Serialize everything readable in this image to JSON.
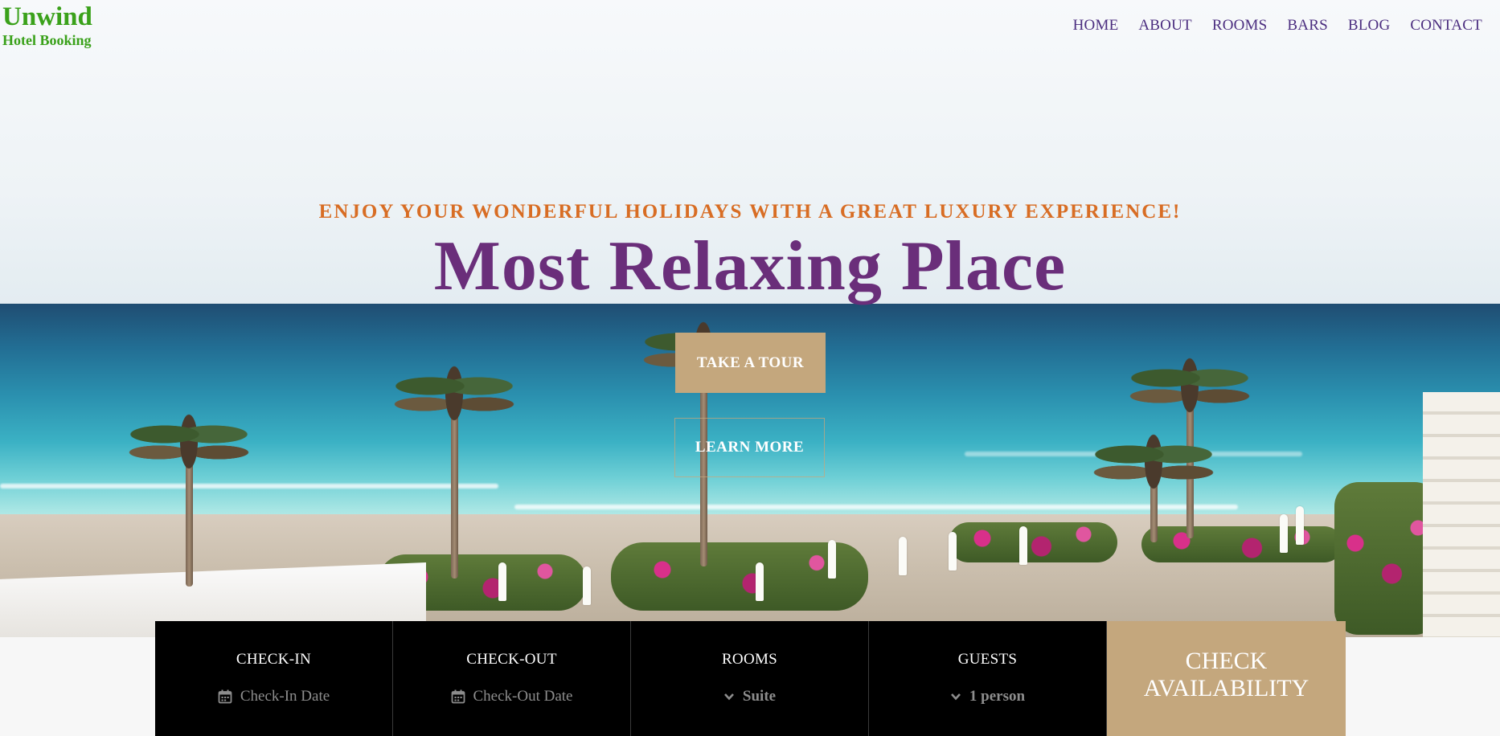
{
  "brand": {
    "name": "Unwind",
    "subtitle": "Hotel Booking",
    "color": "#3aa11a"
  },
  "nav": {
    "items": [
      {
        "label": "HOME"
      },
      {
        "label": "ABOUT"
      },
      {
        "label": "ROOMS"
      },
      {
        "label": "BARS"
      },
      {
        "label": "BLOG"
      },
      {
        "label": "CONTACT"
      }
    ],
    "color": "#4b2d7f"
  },
  "hero": {
    "tagline": "ENJOY YOUR WONDERFUL HOLIDAYS WITH A GREAT LUXURY EXPERIENCE!",
    "headline": "Most Relaxing Place",
    "tour_button": "TAKE A TOUR",
    "learn_button": "LEARN MORE",
    "accent": "#c4a77d",
    "tagline_color": "#d86d24",
    "headline_color": "#6a2e7a"
  },
  "booking": {
    "checkin": {
      "label": "CHECK-IN",
      "placeholder": "Check-In Date",
      "icon": "calendar-icon"
    },
    "checkout": {
      "label": "CHECK-OUT",
      "placeholder": "Check-Out Date",
      "icon": "calendar-icon"
    },
    "rooms": {
      "label": "ROOMS",
      "value": "Suite",
      "icon": "chevron-down-icon"
    },
    "guests": {
      "label": "GUESTS",
      "value": "1 person",
      "icon": "chevron-down-icon"
    },
    "check_button": "CHECK AVAILABILITY"
  }
}
